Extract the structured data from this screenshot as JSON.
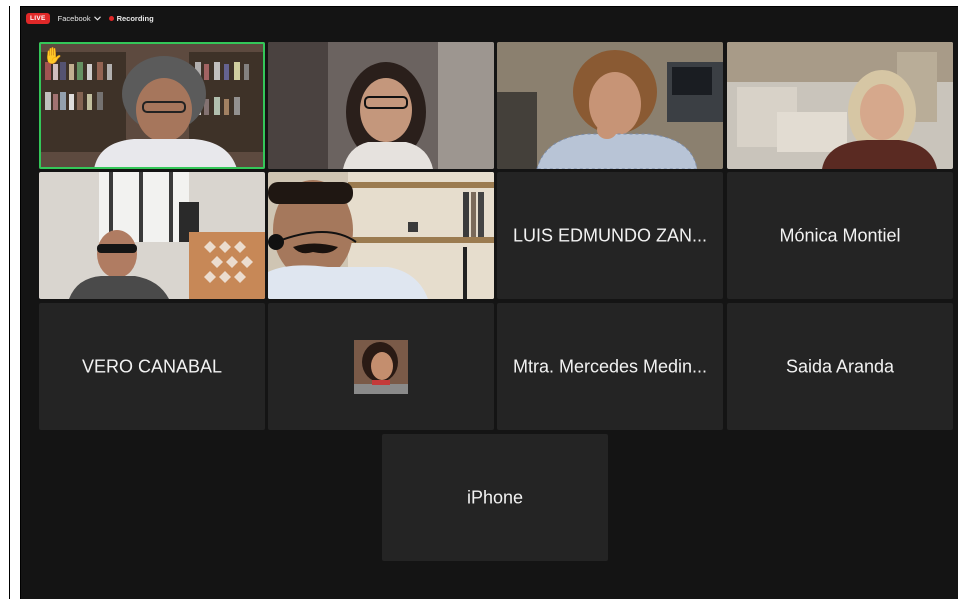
{
  "topbar": {
    "live_label": "LIVE",
    "platform_label": "Facebook",
    "recording_label": "Recording"
  },
  "participants": [
    {
      "name": "LUIS EDMUNDO ZAN..."
    },
    {
      "name": "Mónica Montiel"
    },
    {
      "name": "VERO CANABAL"
    },
    {
      "name": "Mtra. Mercedes Medin..."
    },
    {
      "name": "Saida Aranda"
    },
    {
      "name": "iPhone"
    }
  ],
  "colors": {
    "background": "#141414",
    "tile": "#242424",
    "live": "#e02828",
    "active_speaker": "#34c759"
  },
  "icons": [
    "raised-hand-icon",
    "chevron-down-icon",
    "recording-dot-icon"
  ]
}
